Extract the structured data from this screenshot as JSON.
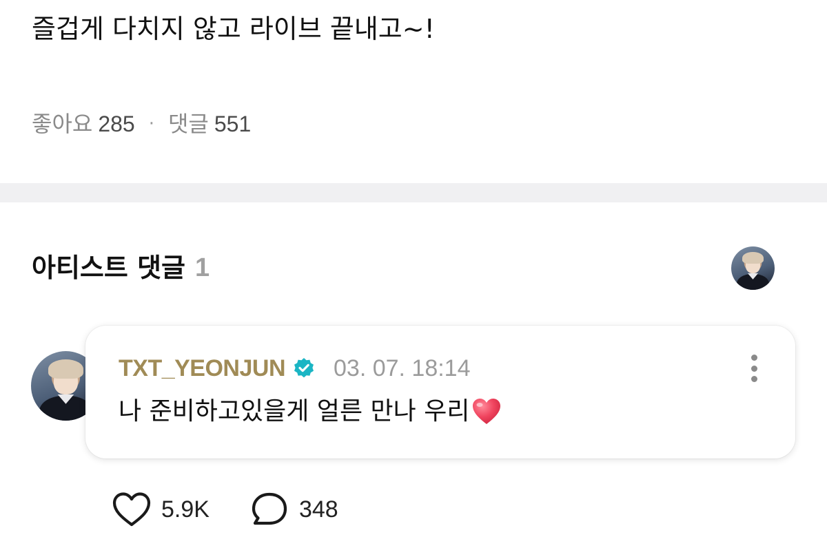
{
  "post": {
    "body": "즐겁게 다치지 않고 라이브 끝내고~!",
    "likes_label": "좋아요",
    "likes_count": "285",
    "separator": "·",
    "comments_label": "댓글",
    "comments_count": "551"
  },
  "artist_section": {
    "title": "아티스트 댓글",
    "count": "1"
  },
  "comment": {
    "author": "TXT_YEONJUN",
    "timestamp": "03. 07. 18:14",
    "text": "나 준비하고있을게 얼른 만나 우리",
    "emoji": "heart-emoji",
    "likes": "5.9K",
    "replies": "348"
  },
  "colors": {
    "author": "#a08b56",
    "verified": "#1bb5c4",
    "heart": "#f0455f",
    "divider": "#f0f0f2"
  },
  "icons": {
    "verified": "verified-badge-icon",
    "more": "more-vertical-icon",
    "like": "heart-outline-icon",
    "reply": "speech-bubble-icon"
  }
}
